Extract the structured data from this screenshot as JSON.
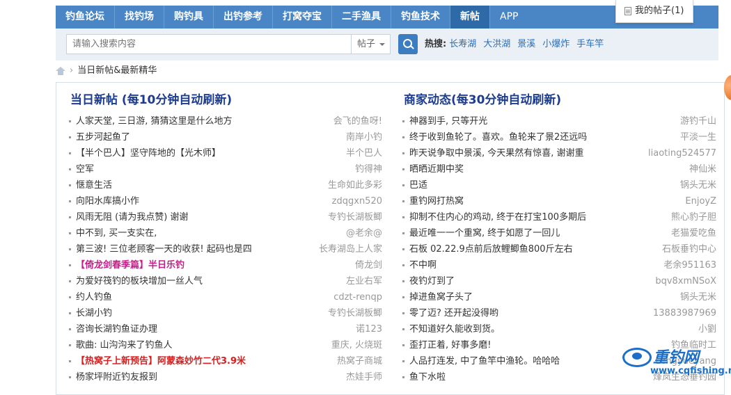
{
  "nav": {
    "items": [
      "钓鱼论坛",
      "找钓场",
      "购钓具",
      "出钓参考",
      "打窝夺宝",
      "二手渔具",
      "钓鱼技术",
      "新帖",
      "APP"
    ],
    "active_index": 7
  },
  "my_posts": "我的帖子(1)",
  "search": {
    "placeholder": "请输入搜索内容",
    "type": "帖子",
    "hot_label": "热搜:",
    "hot_terms": [
      "长寿湖",
      "大洪湖",
      "景溪",
      "小爆炸",
      "手车竿"
    ]
  },
  "breadcrumb": {
    "sep": "›",
    "current": "当日新帖&最新精华"
  },
  "left": {
    "title": "当日新帖 (每10分钟自动刷新)",
    "posts": [
      {
        "title": "人家天堂, 三日游, 猜猜这里是什么地方",
        "author": "会飞的鱼呀!",
        "style": ""
      },
      {
        "title": "五步河起鱼了",
        "author": "南岸小钓",
        "style": ""
      },
      {
        "title": "【半个巴人】坚守阵地的【光木师】",
        "author": "半个巴人",
        "style": ""
      },
      {
        "title": "空军",
        "author": "钓得神",
        "style": ""
      },
      {
        "title": "惬意生活",
        "author": "生命如此多彩",
        "style": ""
      },
      {
        "title": "向阳水库搞小作",
        "author": "zdqgxn520",
        "style": ""
      },
      {
        "title": "风雨无阻 (请为我点赞) 谢谢",
        "author": "专钓长湖板鲫",
        "style": ""
      },
      {
        "title": "中不到, 买一支实在,",
        "author": "@老余@",
        "style": ""
      },
      {
        "title": "第三波! 三位老顾客一天的收获! 起码也是四",
        "author": "长寿湖岛上人家",
        "style": ""
      },
      {
        "title": "【倚龙剑春季篇】半日乐钓",
        "author": "倚龙剑",
        "style": "pink"
      },
      {
        "title": "为爱好筏钓的板块增加一丝人气",
        "author": "左业右军",
        "style": ""
      },
      {
        "title": "约人钓鱼",
        "author": "cdzt-renqp",
        "style": ""
      },
      {
        "title": "长湖小钓",
        "author": "专钓长湖板鲫",
        "style": ""
      },
      {
        "title": "咨询长湖钓鱼证办理",
        "author": "诺123",
        "style": ""
      },
      {
        "title": "歌曲: 山沟沟来了钓鱼人",
        "author": "重庆, 火烧斑",
        "style": ""
      },
      {
        "title": "【热窝子上新预告】阿蒙森妙竹二代3.9米",
        "author": "热窝子商城",
        "style": "red"
      },
      {
        "title": "杨家坪附近钓友报到",
        "author": "杰娃手师",
        "style": ""
      }
    ]
  },
  "right": {
    "title": "商家动态(每30分钟自动刷新)",
    "posts": [
      {
        "title": "神器到手, 只等开光",
        "author": "游钓千山"
      },
      {
        "title": "终于收到鱼轮了。喜欢。鱼轮来了景2还远吗",
        "author": "平淡一生"
      },
      {
        "title": "昨天说争取中景溪, 今天果然有惊喜, 谢谢重",
        "author": "liaoting524577"
      },
      {
        "title": "晒晒近期中奖",
        "author": "神仙米"
      },
      {
        "title": "巴适",
        "author": "锅头无米"
      },
      {
        "title": "重钓网打热窝",
        "author": "EnjoyZ"
      },
      {
        "title": "抑制不住内心的鸡动, 终于在打宝100多期后",
        "author": "熊心豹子胆"
      },
      {
        "title": "最近唯一一个重窝, 终于如愿了一回儿",
        "author": "老猫爱吃鱼"
      },
      {
        "title": "石板 02.22.9点前后放鲤鲫鱼800斤左右",
        "author": "石板垂钓中心"
      },
      {
        "title": "不中啊",
        "author": "老余951163"
      },
      {
        "title": "夜钓灯到了",
        "author": "bqv8xmNSoX"
      },
      {
        "title": "掉进鱼窝子头了",
        "author": "锅头无米"
      },
      {
        "title": "零了迈? 还开起没得哟",
        "author": "13883987969"
      },
      {
        "title": "不知道好久能收到货。",
        "author": "小劉"
      },
      {
        "title": "歪打正着, 好事多磨!",
        "author": "钓鱼临时工"
      },
      {
        "title": "人品打连发, 中了鱼竿中渔轮。哈哈哈",
        "author": "Lengyueyang"
      },
      {
        "title": "鱼下水啦",
        "author": "烽岚生态垂钓园"
      }
    ]
  },
  "watermark": {
    "title": "重钓网",
    "url": "www.cqfishing.net"
  }
}
